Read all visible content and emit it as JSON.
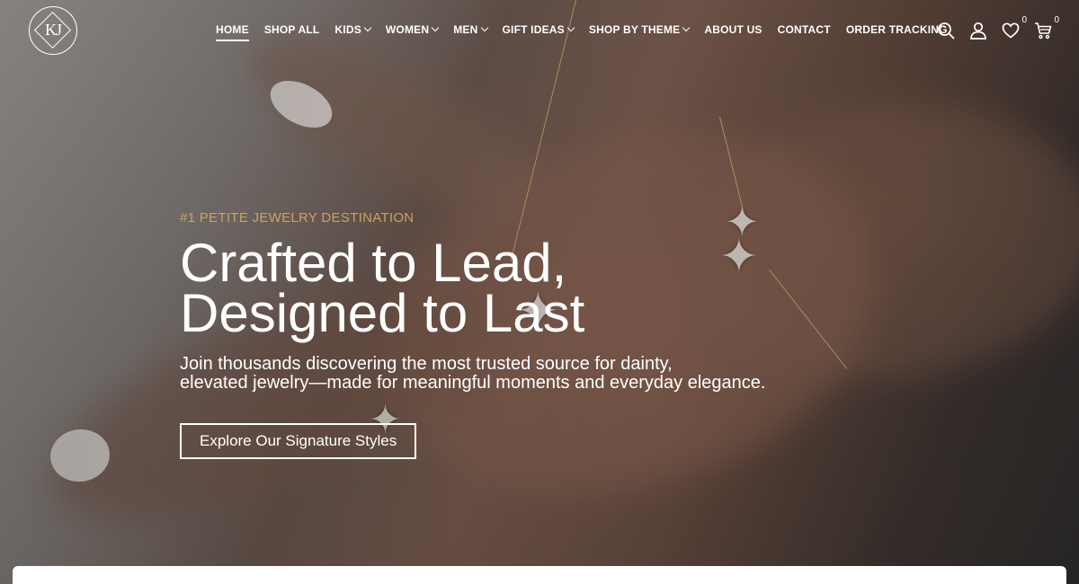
{
  "brand": {
    "logo_monogram": "KJ"
  },
  "nav": {
    "items": [
      {
        "label": "HOME",
        "dropdown": false,
        "active": true
      },
      {
        "label": "SHOP ALL",
        "dropdown": false,
        "active": false
      },
      {
        "label": "KIDS",
        "dropdown": true,
        "active": false
      },
      {
        "label": "WOMEN",
        "dropdown": true,
        "active": false
      },
      {
        "label": "MEN",
        "dropdown": true,
        "active": false
      },
      {
        "label": "GIFT IDEAS",
        "dropdown": true,
        "active": false
      },
      {
        "label": "SHOP BY THEME",
        "dropdown": true,
        "active": false
      },
      {
        "label": "ABOUT US",
        "dropdown": false,
        "active": false
      },
      {
        "label": "CONTACT",
        "dropdown": false,
        "active": false
      },
      {
        "label": "ORDER TRACKING",
        "dropdown": false,
        "active": false
      }
    ]
  },
  "header_icons": {
    "search": "search-icon",
    "account": "user-icon",
    "wishlist": "heart-icon",
    "wishlist_count": "0",
    "cart": "cart-icon",
    "cart_count": "0"
  },
  "hero": {
    "eyebrow": "#1 PETITE JEWELRY DESTINATION",
    "headline_line1": "Crafted to Lead,",
    "headline_line2": "Designed to Last",
    "sub_line1": "Join thousands discovering the most trusted source for dainty,",
    "sub_line2": "elevated jewelry—made for meaningful moments and everyday elegance.",
    "cta_label": "Explore Our Signature Styles"
  },
  "colors": {
    "accent_gold": "#c9a45c",
    "text_white": "#ffffff"
  }
}
